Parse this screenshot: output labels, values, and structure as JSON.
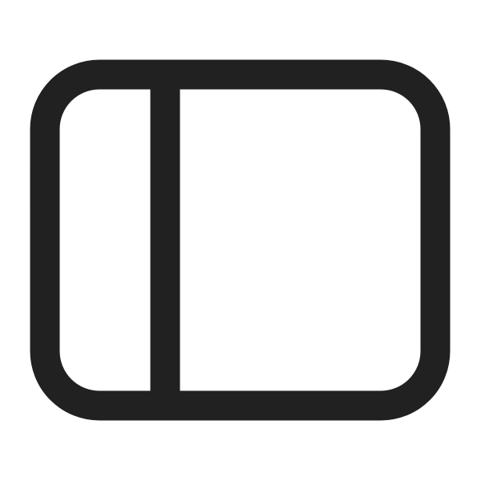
{
  "icon": {
    "name": "sidebar-panel-icon",
    "stroke_color": "#212121",
    "background_color": "#ffffff"
  }
}
